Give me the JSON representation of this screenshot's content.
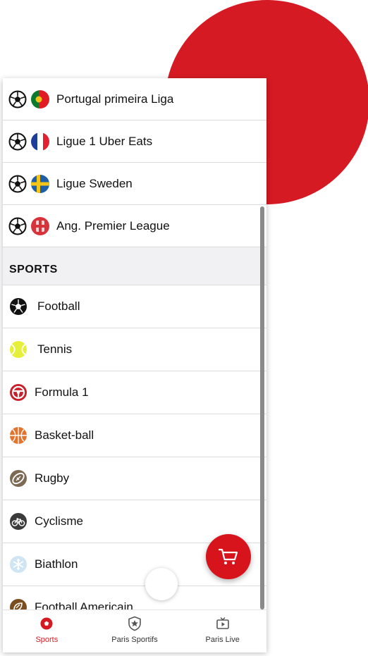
{
  "leagues": [
    {
      "label": "Portugal primeira Liga",
      "flag": "portugal-flag-icon"
    },
    {
      "label": "Ligue 1 Uber Eats",
      "flag": "france-flag-icon"
    },
    {
      "label": "Ligue Sweden",
      "flag": "sweden-flag-icon"
    },
    {
      "label": "Ang. Premier League",
      "flag": "england-flag-icon"
    }
  ],
  "sports_section": {
    "title": "SPORTS"
  },
  "sports": [
    {
      "label": "Football",
      "icon": "football-icon"
    },
    {
      "label": "Tennis",
      "icon": "tennis-ball-icon"
    },
    {
      "label": "Formula 1",
      "icon": "steering-wheel-icon"
    },
    {
      "label": "Basket-ball",
      "icon": "basketball-icon"
    },
    {
      "label": "Rugby",
      "icon": "rugby-ball-icon"
    },
    {
      "label": "Cyclisme",
      "icon": "bicycle-icon"
    },
    {
      "label": "Biathlon",
      "icon": "snowflake-icon"
    },
    {
      "label": "Football Americain",
      "icon": "american-football-icon"
    }
  ],
  "bottom_nav": [
    {
      "label": "Sports",
      "icon": "football-icon",
      "active": true
    },
    {
      "label": "Paris Sportifs",
      "icon": "star-shield-icon",
      "active": false
    },
    {
      "label": "Paris Live",
      "icon": "tv-play-icon",
      "active": false
    }
  ],
  "colors": {
    "accent": "#d61a23",
    "fab": "#d7141c"
  },
  "cart": {
    "icon": "shopping-cart-icon"
  }
}
